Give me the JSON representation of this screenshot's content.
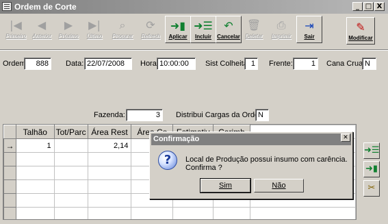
{
  "window": {
    "title": "Ordem de Corte",
    "buttons": [
      "_",
      "□",
      "X"
    ]
  },
  "toolbar": [
    {
      "label": "Primeiro",
      "icon": "first-record-icon",
      "glyph": "|◀",
      "enabled": false
    },
    {
      "label": "Anterior",
      "icon": "previous-record-icon",
      "glyph": "◀",
      "enabled": false
    },
    {
      "label": "Próximo",
      "icon": "next-record-icon",
      "glyph": "▶",
      "enabled": false
    },
    {
      "label": "Último",
      "icon": "last-record-icon",
      "glyph": "▶|",
      "enabled": false
    },
    {
      "label": "Procurar",
      "icon": "search-record-icon",
      "glyph": "⌕",
      "enabled": false
    },
    {
      "label": "Refresh",
      "icon": "refresh-icon",
      "glyph": "⟳",
      "enabled": false
    },
    {
      "label": "Aplicar",
      "icon": "apply-icon",
      "glyph": "➜▮",
      "enabled": true
    },
    {
      "label": "Incluir",
      "icon": "insert-icon",
      "glyph": "➜☰",
      "enabled": true
    },
    {
      "label": "Cancelar",
      "icon": "cancel-icon",
      "glyph": "↶",
      "enabled": true
    },
    {
      "label": "Deletar",
      "icon": "delete-icon",
      "glyph": "🗑",
      "enabled": false
    },
    {
      "label": "Imprimir",
      "icon": "print-icon",
      "glyph": "⎙",
      "enabled": false
    },
    {
      "label": "Sair",
      "icon": "exit-icon",
      "glyph": "⇥",
      "enabled": true
    },
    {
      "label": "Modificar",
      "icon": "modify-icon",
      "glyph": "✎",
      "enabled": true
    }
  ],
  "form": {
    "ordem_label": "Ordem",
    "ordem_value": "888",
    "data_label": "Data:",
    "data_value": "22/07/2008",
    "hora_label": "Hora",
    "hora_value": "10:00:00",
    "sist_label": "Sist Colheita:",
    "sist_value": "1",
    "frente_label": "Frente:",
    "frente_value": "1",
    "cana_label": "Cana Crua:",
    "cana_value": "N",
    "fazenda_label": "Fazenda:",
    "fazenda_value": "3",
    "distribui_label": "Distribui Cargas da Ordem:",
    "distribui_value": "N"
  },
  "grid": {
    "columns": [
      "Talhão",
      "Tot/Parc",
      "Área Rest",
      "Área Co",
      "Estimativ",
      "Carimb"
    ],
    "rows": [
      {
        "indicator": "→",
        "cells": [
          "1",
          "",
          "2,14",
          "",
          "",
          ""
        ]
      },
      {
        "indicator": "",
        "cells": [
          "",
          "",
          "",
          "",
          "",
          ""
        ]
      },
      {
        "indicator": "",
        "cells": [
          "",
          "",
          "",
          "",
          "",
          ""
        ]
      },
      {
        "indicator": "",
        "cells": [
          "",
          "",
          "",
          "",
          "",
          ""
        ]
      },
      {
        "indicator": "",
        "cells": [
          "",
          "",
          "",
          "",
          "",
          ""
        ]
      },
      {
        "indicator": "",
        "cells": [
          "",
          "",
          "",
          "",
          "",
          ""
        ]
      }
    ]
  },
  "side_buttons": [
    {
      "icon": "insert-row-icon",
      "glyph": "➜☰"
    },
    {
      "icon": "apply-row-icon",
      "glyph": "➜▮"
    },
    {
      "icon": "delete-row-icon",
      "glyph": "✂"
    }
  ],
  "dialog": {
    "title": "Confirmação",
    "message": "Local de Produção possui insumo com carência. Confirma ?",
    "yes_label": "Sim",
    "no_label": "Não"
  }
}
